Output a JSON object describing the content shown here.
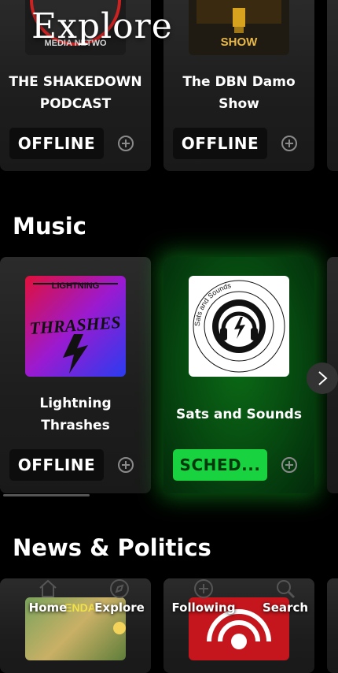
{
  "header": {
    "title": "Explore"
  },
  "podcasts": [
    {
      "title": "THE SHAKEDOWN PODCAST",
      "status": "OFFLINE",
      "art_text": "MEDIA NETWO"
    },
    {
      "title": "The DBN Damo Show",
      "status": "OFFLINE",
      "art_text": "SHOW"
    }
  ],
  "music": {
    "title": "Music",
    "items": [
      {
        "title": "Lightning Thrashes",
        "status": "OFFLINE",
        "art_top": "LIGHTNING",
        "art_main": "THRASHES"
      },
      {
        "title": "Sats and Sounds",
        "status": "SCHED...",
        "art_ring": "Sats and Sounds"
      }
    ]
  },
  "news": {
    "title": "News & Politics",
    "items": [
      {
        "art_text": "ENDA"
      },
      {
        "art_text": ""
      }
    ]
  },
  "nav": {
    "items": [
      {
        "label": "Home",
        "icon": "home-icon"
      },
      {
        "label": "Explore",
        "icon": "compass-icon"
      },
      {
        "label": "Following",
        "icon": "plus-circle-icon"
      },
      {
        "label": "Search",
        "icon": "search-icon"
      }
    ]
  },
  "colors": {
    "live_green": "#18d23f",
    "active_dot": "#f3d35a"
  }
}
